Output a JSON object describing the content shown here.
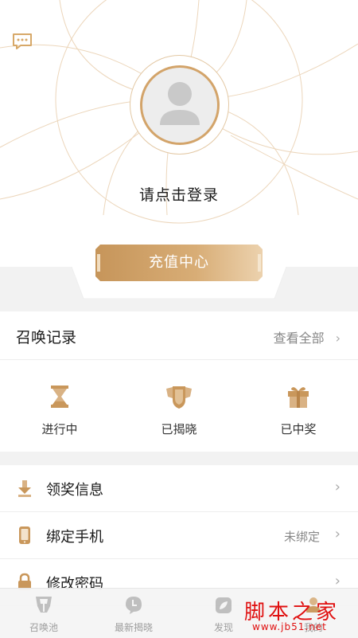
{
  "header": {
    "login_prompt": "请点击登录",
    "recharge_label": "充值中心"
  },
  "records": {
    "title": "召唤记录",
    "view_all": "查看全部",
    "chevron": "›",
    "statuses": [
      {
        "label": "进行中",
        "icon": "hourglass-icon"
      },
      {
        "label": "已揭晓",
        "icon": "shield-badge-icon"
      },
      {
        "label": "已中奖",
        "icon": "gift-icon"
      }
    ]
  },
  "menu": [
    {
      "label": "领奖信息",
      "value": "",
      "icon": "download-arrow-icon"
    },
    {
      "label": "绑定手机",
      "value": "未绑定",
      "icon": "phone-icon"
    },
    {
      "label": "修改密码",
      "value": "",
      "icon": "lock-icon"
    }
  ],
  "tabbar": [
    {
      "label": "召唤池",
      "icon": "transformer-logo-icon"
    },
    {
      "label": "最新揭晓",
      "icon": "clock-bubble-icon"
    },
    {
      "label": "发现",
      "icon": "leaf-compass-icon"
    },
    {
      "label": "我的",
      "icon": "person-icon"
    }
  ],
  "watermark": {
    "main": "脚本之家",
    "sub": "www.jb51.net"
  },
  "colors": {
    "gold": "#c9975b",
    "gold_light": "#e6c9a3",
    "gray_icon": "#b8b8b8",
    "watermark_red": "#e01010"
  }
}
